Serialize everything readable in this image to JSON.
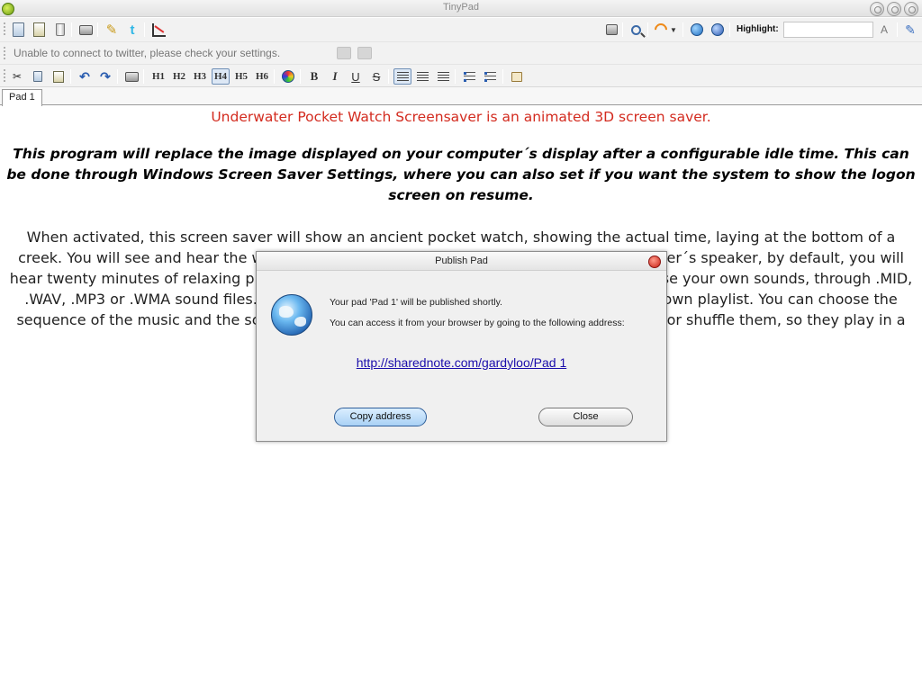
{
  "window": {
    "title": "TinyPad"
  },
  "toolbar": {
    "highlight_label": "Highlight:",
    "highlight_value": ""
  },
  "status": {
    "message": "Unable to connect to twitter, please check your settings."
  },
  "format": {
    "h1": "H1",
    "h2": "H2",
    "h3": "H3",
    "h4": "H4",
    "h5": "H5",
    "h6": "H6",
    "bold": "B",
    "italic": "I",
    "underline": "U",
    "strike": "S",
    "active_heading": "H4"
  },
  "icons": {
    "toolbar1": [
      "new-document-icon",
      "edit-document-icon",
      "delete-icon",
      "print-icon",
      "sign-icon",
      "twitter-icon",
      "chart-icon"
    ],
    "toolbar1_right": [
      "device-icon",
      "search-icon",
      "rss-icon",
      "dropdown-icon",
      "globe-icon",
      "info-icon",
      "highlight-color-icon",
      "pencil-icon"
    ],
    "toolbar3": [
      "cut-icon",
      "copy-icon",
      "paste-icon",
      "undo-icon",
      "redo-icon",
      "print-icon",
      "color-palette-icon",
      "align-left-icon",
      "align-center-icon",
      "align-right-icon",
      "numbered-list-icon",
      "bulleted-list-icon",
      "table-icon"
    ]
  },
  "tabs": [
    {
      "label": "Pad 1"
    }
  ],
  "editor": {
    "line1": "Underwater Pocket Watch Screensaver is an animated 3D screen saver.",
    "line2": "This program will replace the image displayed on your computer´s display after a configurable idle time. This can be done through Windows Screen Saver Settings, where you can also set if you want the system to show the logon screen on resume.",
    "line3": "When activated, this screen saver will show an ancient pocket watch, showing the actual time, laying at the bottom of a creek. You will see and hear the water flowing and dragonflies flying. Through the computer´s speaker, by default, you will hear twenty minutes of relaxing piano music, that will be played in a sequential order or use your own sounds, through .MID, .WAV, .MP3 or .WMA sound files. When you choose to use those files, you will build your own playlist. You can choose the sequence of the music and the screen saver will play the songs according to that sorting, or shuffle them, so they play in a random order, and repeat the repeatedly.",
    "colors": {
      "line1": "#d32b1f"
    }
  },
  "modal": {
    "title": "Publish Pad",
    "text1": "Your pad 'Pad 1' will be published shortly.",
    "text2": "You can access it from your browser by going to the following address:",
    "link": "http://sharednote.com/gardyloo/Pad 1",
    "copy_button": "Copy address",
    "close_button": "Close"
  }
}
